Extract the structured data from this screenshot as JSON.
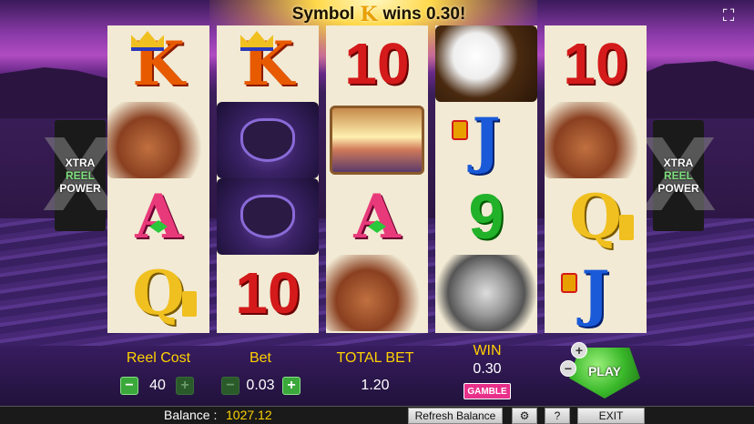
{
  "banner": {
    "prefix": "Symbol",
    "symbol_glyph": "K",
    "suffix": "wins 0.30!"
  },
  "side_panel": {
    "line1": "XTRA",
    "line2": "REEL",
    "line3": "POWER",
    "big_glyph": "X"
  },
  "reels": [
    [
      "K",
      "elk",
      "A",
      "Q"
    ],
    [
      "K",
      "buffalo",
      "buffalo",
      "10"
    ],
    [
      "10",
      "sunset",
      "A",
      "elk"
    ],
    [
      "eagle",
      "J",
      "9",
      "wolf"
    ],
    [
      "10",
      "elk",
      "Q",
      "J"
    ]
  ],
  "controls": {
    "reel_cost_label": "Reel Cost",
    "reel_cost_value": "40",
    "bet_label": "Bet",
    "bet_value": "0.03",
    "total_bet_label": "TOTAL BET",
    "total_bet_value": "1.20",
    "win_label": "WIN",
    "win_value": "0.30",
    "gamble_label": "GAMBLE",
    "play_label": "PLAY",
    "minus": "−",
    "plus": "+"
  },
  "status": {
    "balance_label": "Balance :",
    "balance_value": "1027.12",
    "refresh_label": "Refresh Balance",
    "settings_glyph": "⚙",
    "help_label": "?",
    "exit_label": "EXIT"
  },
  "fullscreen_glyph": "⛶"
}
